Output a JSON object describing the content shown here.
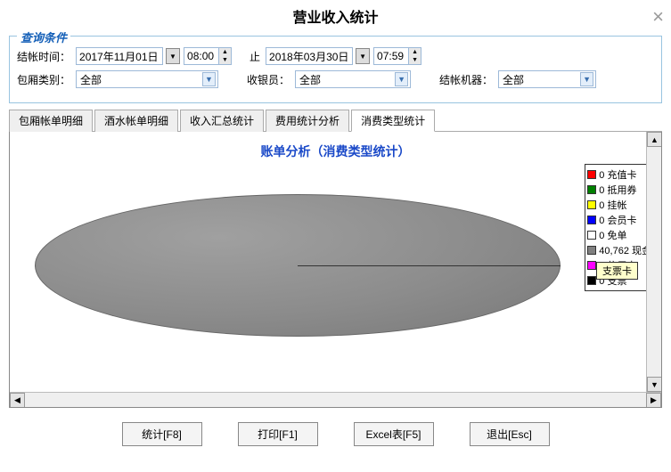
{
  "title": "营业收入统计",
  "conditions": {
    "groupTitle": "查询条件",
    "timeLabel": "结帐时间：",
    "dateFrom": "2017年11月01日",
    "timeFrom": "08:00",
    "toLabel": "止",
    "dateTo": "2018年03月30日",
    "timeTo": "07:59",
    "roomTypeLabel": "包厢类别：",
    "roomTypeValue": "全部",
    "cashierLabel": "收银员：",
    "cashierValue": "全部",
    "machineLabel": "结帐机器：",
    "machineValue": "全部"
  },
  "tabs": [
    {
      "label": "包厢帐单明细",
      "active": false
    },
    {
      "label": "酒水帐单明细",
      "active": false
    },
    {
      "label": "收入汇总统计",
      "active": false
    },
    {
      "label": "费用统计分析",
      "active": false
    },
    {
      "label": "消费类型统计",
      "active": true
    }
  ],
  "chart_data": {
    "type": "pie",
    "title": "账单分析（消费类型统计）",
    "series": [
      {
        "name": "充值卡",
        "value": 0,
        "color": "#ff0000"
      },
      {
        "name": "抵用券",
        "value": 0,
        "color": "#008000"
      },
      {
        "name": "挂帐",
        "value": 0,
        "color": "#ffff00"
      },
      {
        "name": "会员卡",
        "value": 0,
        "color": "#0000ff"
      },
      {
        "name": "免单",
        "value": 0,
        "color": "#ffffff"
      },
      {
        "name": "现金",
        "value": 40762,
        "color": "#808080"
      },
      {
        "name": "信用卡",
        "value": 0,
        "color": "#ff00ff"
      },
      {
        "name": "支票",
        "value": 0,
        "color": "#000000"
      }
    ],
    "tooltip": "支票卡"
  },
  "buttons": {
    "stat": "统计[F8]",
    "print": "打印[F1]",
    "excel": "Excel表[F5]",
    "exit": "退出[Esc]"
  }
}
